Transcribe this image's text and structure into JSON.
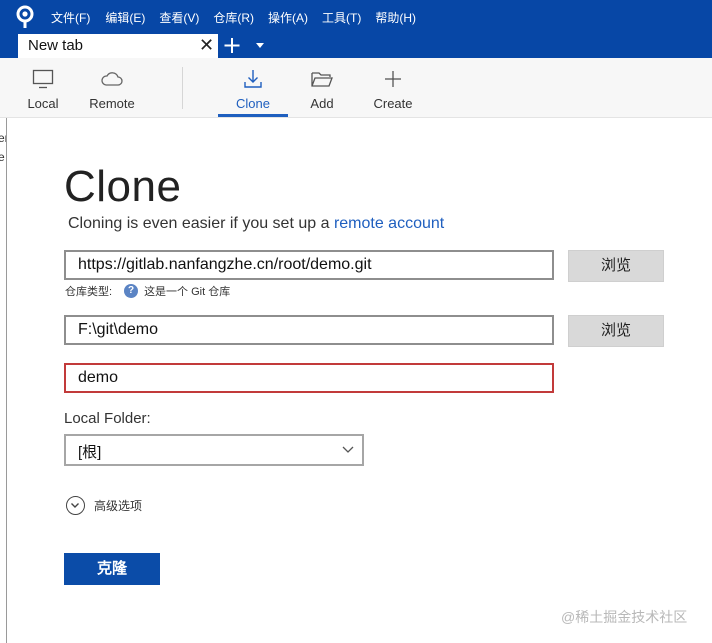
{
  "menu": {
    "items": [
      "文件(F)",
      "编辑(E)",
      "查看(V)",
      "仓库(R)",
      "操作(A)",
      "工具(T)",
      "帮助(H)"
    ]
  },
  "tab": {
    "title": "New tab",
    "close": "✕",
    "add": "+"
  },
  "toolbar": {
    "local": "Local",
    "remote": "Remote",
    "clone": "Clone",
    "add": "Add",
    "create": "Create"
  },
  "left_pane": {
    "fragments": [
      "ol",
      "er",
      "e"
    ]
  },
  "page": {
    "title": "Clone",
    "subtitle_prefix": "Cloning is even easier if you set up a ",
    "subtitle_link": "remote account"
  },
  "source": {
    "url": "https://gitlab.nanfangzhe.cn/root/demo.git",
    "browse": "浏览",
    "repo_type_label": "仓库类型:",
    "repo_type_icon": "?",
    "repo_type_value": "这是一个 Git 仓库"
  },
  "dest": {
    "path": "F:\\git\\demo",
    "browse": "浏览"
  },
  "name": {
    "value": "demo"
  },
  "local_folder": {
    "label": "Local Folder:",
    "selected": "[根]"
  },
  "advanced": {
    "label": "高级选项"
  },
  "actions": {
    "clone_button": "克隆"
  },
  "watermark": "@稀土掘金技术社区",
  "colors": {
    "accent": "#0747a6",
    "link": "#1f5fbf",
    "error_border": "#c23a3a",
    "button": "#0b4ca8"
  }
}
